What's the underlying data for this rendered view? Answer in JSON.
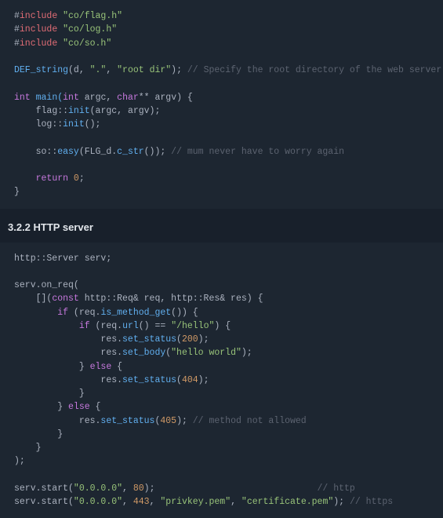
{
  "block1": {
    "inc1_kw": "include",
    "inc1_str": "\"co/flag.h\"",
    "inc2_kw": "include",
    "inc2_str": "\"co/log.h\"",
    "inc3_kw": "include",
    "inc3_str": "\"co/so.h\"",
    "def_macro": "DEF_string",
    "def_arg1": "(d, ",
    "def_str1": "\".\"",
    "def_mid": ", ",
    "def_str2": "\"root dir\"",
    "def_end": ");",
    "def_cmt": " // Specify the root directory of the web server",
    "main_int": "int",
    "main_name": " main(",
    "main_int2": "int",
    "main_argc": " argc, ",
    "main_char": "char",
    "main_argv": "** argv) {",
    "flag_ns": "flag::",
    "flag_fn": "init",
    "flag_args": "(argc, argv);",
    "log_ns": "log::",
    "log_fn": "init",
    "log_args": "();",
    "so_ns": "so::",
    "so_fn": "easy",
    "so_arg1": "(FLG_d.",
    "so_cstr": "c_str",
    "so_arg2": "());",
    "so_cmt": " // mum never have to worry again",
    "ret_kw": "return",
    "ret_val": " 0",
    "ret_end": ";",
    "close": "}"
  },
  "heading": "3.2.2 HTTP server",
  "block2": {
    "l1": "http::Server serv;",
    "l2": "serv.on_req(",
    "l3_a": "    [](",
    "l3_const": "const",
    "l3_b": " http::Req& req, http::Res& res) {",
    "l4_a": "        ",
    "l4_if": "if",
    "l4_b": " (req.",
    "l4_fn": "is_method_get",
    "l4_c": "()) {",
    "l5_a": "            ",
    "l5_if": "if",
    "l5_b": " (req.",
    "l5_fn": "url",
    "l5_c": "() == ",
    "l5_str": "\"/hello\"",
    "l5_d": ") {",
    "l6_a": "                res.",
    "l6_fn": "set_status",
    "l6_b": "(",
    "l6_num": "200",
    "l6_c": ");",
    "l7_a": "                res.",
    "l7_fn": "set_body",
    "l7_b": "(",
    "l7_str": "\"hello world\"",
    "l7_c": ");",
    "l8_a": "            } ",
    "l8_else": "else",
    "l8_b": " {",
    "l9_a": "                res.",
    "l9_fn": "set_status",
    "l9_b": "(",
    "l9_num": "404",
    "l9_c": ");",
    "l10": "            }",
    "l11_a": "        } ",
    "l11_else": "else",
    "l11_b": " {",
    "l12_a": "            res.",
    "l12_fn": "set_status",
    "l12_b": "(",
    "l12_num": "405",
    "l12_c": ");",
    "l12_cmt": " // method not allowed",
    "l13": "        }",
    "l14": "    }",
    "l15": ");",
    "l16_a": "serv.start(",
    "l16_s1": "\"0.0.0.0\"",
    "l16_b": ", ",
    "l16_n": "80",
    "l16_c": ");",
    "l16_pad": "                             ",
    "l16_cmt": " // http",
    "l17_a": "serv.start(",
    "l17_s1": "\"0.0.0.0\"",
    "l17_b": ", ",
    "l17_n": "443",
    "l17_c": ", ",
    "l17_s2": "\"privkey.pem\"",
    "l17_d": ", ",
    "l17_s3": "\"certificate.pem\"",
    "l17_e": ");",
    "l17_cmt": " // https"
  }
}
